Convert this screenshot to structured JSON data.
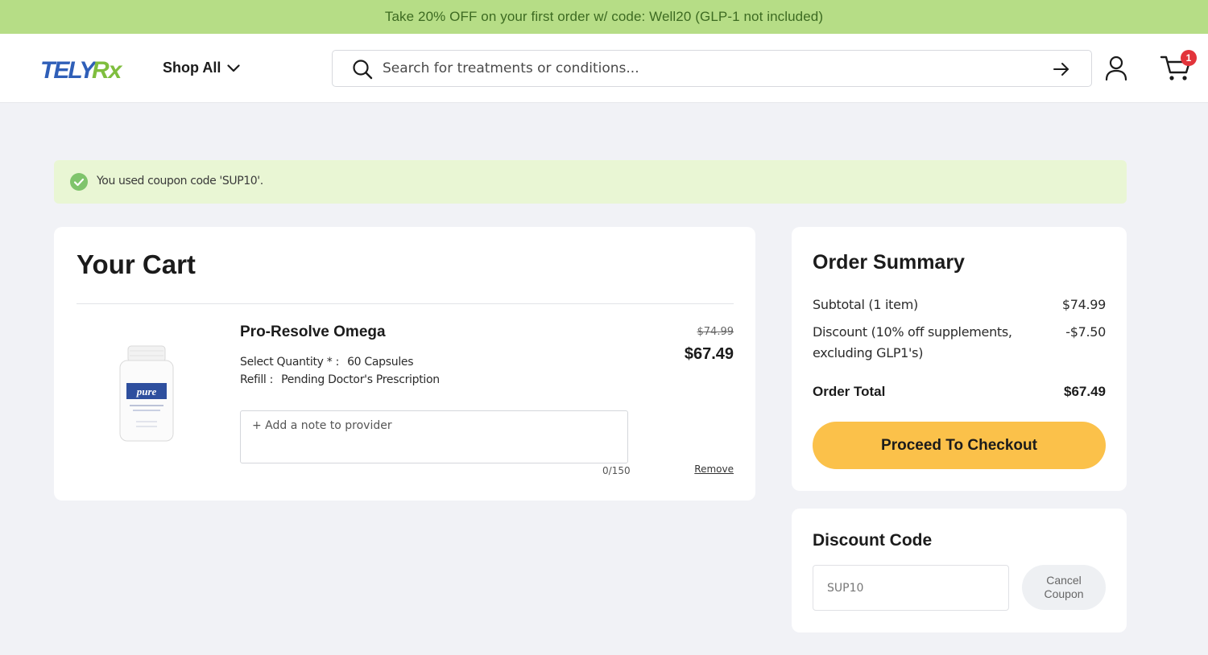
{
  "promo_banner": {
    "text": "Take 20% OFF on your first order w/ code: Well20 (GLP-1 not included)"
  },
  "header": {
    "logo_text": "TELYRx",
    "shop_all_label": "Shop All",
    "search_placeholder": "Search for treatments or conditions...",
    "cart_count": "1",
    "icons": [
      "search-icon",
      "arrow-right-icon",
      "user-icon",
      "cart-icon",
      "chevron-down-icon"
    ]
  },
  "alert": {
    "message": "You used coupon code 'SUP10'."
  },
  "cart": {
    "title": "Your Cart",
    "items": [
      {
        "name": "Pro-Resolve Omega",
        "quantity_label": "Select Quantity * :",
        "quantity_value": "60 Capsules",
        "refill_label": "Refill :",
        "refill_value": "Pending Doctor's Prescription",
        "price_original": "$74.99",
        "price_current": "$67.49",
        "note_placeholder": "+ Add a note to provider",
        "note_counter": "0/150",
        "remove_label": "Remove",
        "image_brand_text": "pure"
      }
    ]
  },
  "summary": {
    "title": "Order Summary",
    "subtotal_label": "Subtotal (1 item)",
    "subtotal_value": "$74.99",
    "discount_label": "Discount (10% off supplements, excluding GLP1's)",
    "discount_value": "-$7.50",
    "total_label": "Order Total",
    "total_value": "$67.49",
    "checkout_label": "Proceed To Checkout"
  },
  "discount": {
    "title": "Discount Code",
    "code_value": "SUP10",
    "cancel_label": "Cancel Coupon"
  },
  "colors": {
    "promo_bg": "#b6dd86",
    "promo_text": "#3d6b22",
    "alert_bg": "#e9f6d4",
    "check_green": "#7fc46c",
    "checkout_btn": "#fbc14a",
    "badge_red": "#e2343b",
    "logo_blue": "#2f5fb8",
    "logo_green": "#7fbe3e"
  }
}
